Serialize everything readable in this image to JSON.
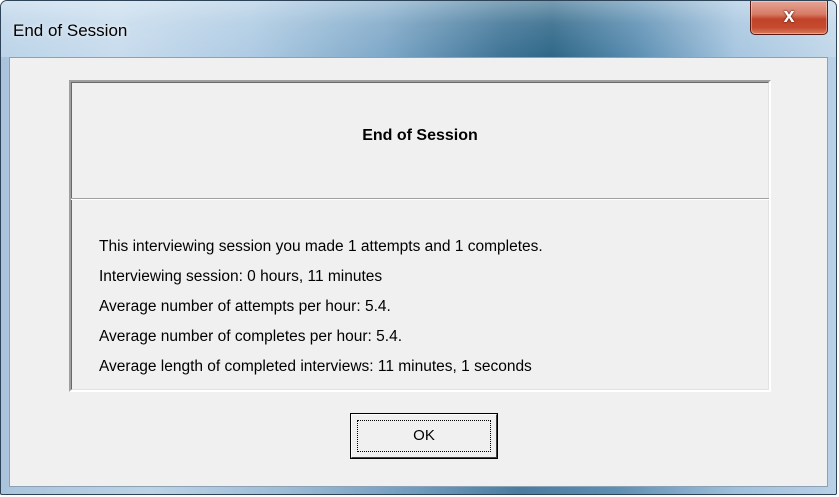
{
  "window": {
    "title": "End of Session",
    "close_icon": "close-icon",
    "close_glyph": "x"
  },
  "panel": {
    "heading": "End of Session",
    "lines": [
      "This interviewing session you made 1 attempts and 1 completes.",
      "Interviewing session: 0 hours, 11 minutes",
      "Average number of attempts per hour: 5.4.",
      "Average number of completes per hour: 5.4.",
      "Average length of completed interviews: 11 minutes, 1 seconds"
    ]
  },
  "buttons": {
    "ok_label": "OK"
  },
  "colors": {
    "close_button": "#c44a2e",
    "client_background": "#f0f0f0"
  }
}
